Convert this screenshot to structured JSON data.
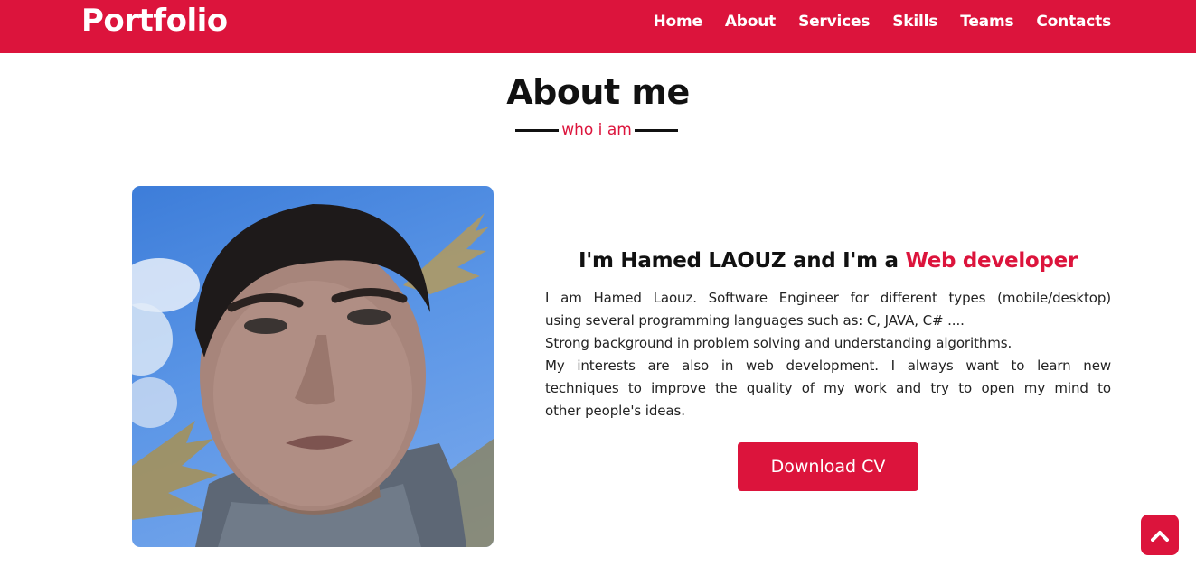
{
  "header": {
    "logo": "Portfolio",
    "nav": [
      {
        "label": "Home"
      },
      {
        "label": "About"
      },
      {
        "label": "Services"
      },
      {
        "label": "Skills"
      },
      {
        "label": "Teams"
      },
      {
        "label": "Contacts"
      }
    ]
  },
  "about": {
    "title": "About me",
    "subtitle": "who i am",
    "photo_alt": "profile-photo",
    "heading_prefix": "I'm Hamed LAOUZ and I'm a ",
    "heading_accent": "Web developer",
    "paragraph_lines": [
      "I am Hamed Laouz. Software Engineer for different types (mobile/desktop)",
      "using several programming languages such as: C, JAVA, C# ....",
      "Strong background in problem solving and understanding algorithms.",
      "My interests are also in web development. I always want to learn new",
      "techniques to improve the quality of my work and try to open my mind to",
      "other people's ideas."
    ],
    "button_label": "Download CV"
  },
  "scroll_top": {
    "icon": "chevron-up-icon"
  },
  "colors": {
    "accent": "#dc143c",
    "text": "#111111",
    "background": "#ffffff"
  }
}
